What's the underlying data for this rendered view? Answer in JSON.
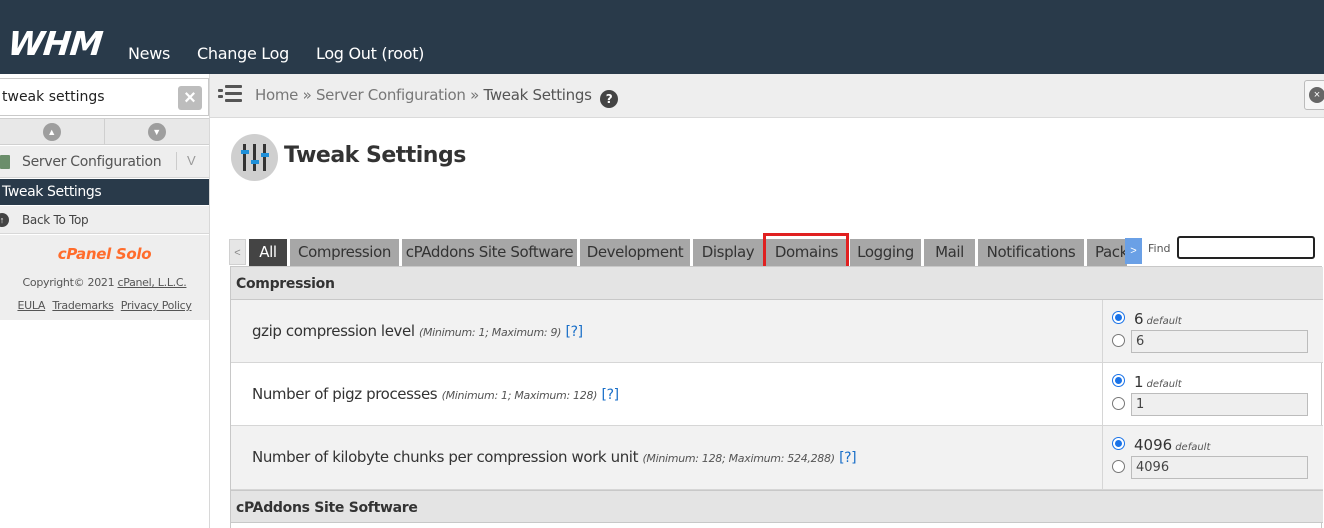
{
  "header": {
    "logo": "WHM",
    "nav": [
      "News",
      "Change Log",
      "Log Out (root)"
    ]
  },
  "sidebar": {
    "search_value": "tweak settings",
    "category": "Server Configuration",
    "active_item": "Tweak Settings",
    "back_to_top": "Back To Top",
    "brand": "cPanel Solo",
    "copyright_prefix": "Copyright© 2021 ",
    "copyright_company": "cPanel, L.L.C.",
    "legal": [
      "EULA",
      "Trademarks",
      "Privacy Policy"
    ]
  },
  "breadcrumb": {
    "home": "Home",
    "sep": "»",
    "section": "Server Configuration",
    "current": "Tweak Settings",
    "help": "?"
  },
  "page": {
    "title": "Tweak Settings"
  },
  "tabs": {
    "prev": "<",
    "next": ">",
    "items": [
      "All",
      "Compression",
      "cPAddons Site Software",
      "Development",
      "Display",
      "Domains",
      "Logging",
      "Mail",
      "Notifications",
      "Pack"
    ],
    "active": "All",
    "highlighted": "Domains",
    "find_label": "Find",
    "find_value": ""
  },
  "sections": [
    {
      "title": "Compression",
      "rows": [
        {
          "label": "gzip compression level",
          "range": "(Minimum: 1; Maximum: 9)",
          "help": "[?]",
          "default_value": "6",
          "default_label": "default",
          "input_value": "6"
        },
        {
          "label": "Number of pigz processes",
          "range": "(Minimum: 1; Maximum: 128)",
          "help": "[?]",
          "default_value": "1",
          "default_label": "default",
          "input_value": "1"
        },
        {
          "label": "Number of kilobyte chunks per compression work unit",
          "range": "(Minimum: 128; Maximum: 524,288)",
          "help": "[?]",
          "default_value": "4096",
          "default_label": "default",
          "input_value": "4096"
        }
      ]
    },
    {
      "title": "cPAddons Site Software",
      "rows": []
    }
  ],
  "colors": {
    "topbar": "#293a4a",
    "accent_orange": "#ff6c2c",
    "link_blue": "#1a6fc8",
    "highlight_red": "#e02020"
  }
}
